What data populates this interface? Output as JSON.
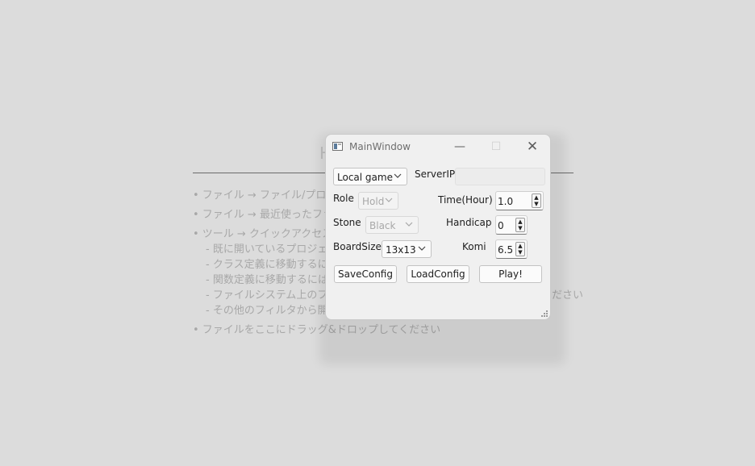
{
  "background": {
    "heading": "H",
    "lines": [
      "• ファイル → ファイル/プロジェクト",
      "• ファイル → 最近使ったファイ",
      "• ツール → クイックアクセス (C",
      "- 既に開いているプロジェクト",
      "- クラス定義に移動するには",
      "- 関数定義に移動するには",
      "- ファイルシステム上のファイ",
      "- その他のフィルタから開き",
      "• ファイルをここにドラッグ&ドロップしてください"
    ],
    "overflow_text": "ださい"
  },
  "window": {
    "title": "MainWindow",
    "controls": {
      "minimize": "—",
      "maximize": "☐",
      "close": "✕"
    }
  },
  "form": {
    "mode_select": "Local game",
    "server_ip_label": "ServerIP",
    "server_ip_value": "",
    "role_label": "Role",
    "role_value": "Hold",
    "time_label": "Time(Hour)",
    "time_value": "1.0",
    "stone_label": "Stone",
    "stone_value": "Black",
    "handicap_label": "Handicap",
    "handicap_value": "0",
    "boardsize_label": "BoardSize",
    "boardsize_value": "13x13",
    "komi_label": "Komi",
    "komi_value": "6.5"
  },
  "buttons": {
    "save": "SaveConfig",
    "load": "LoadConfig",
    "play": "Play!"
  },
  "icons": {
    "chevron": "chevron-down-icon",
    "spin_up": "triangle-up-icon",
    "spin_down": "triangle-down-icon"
  }
}
